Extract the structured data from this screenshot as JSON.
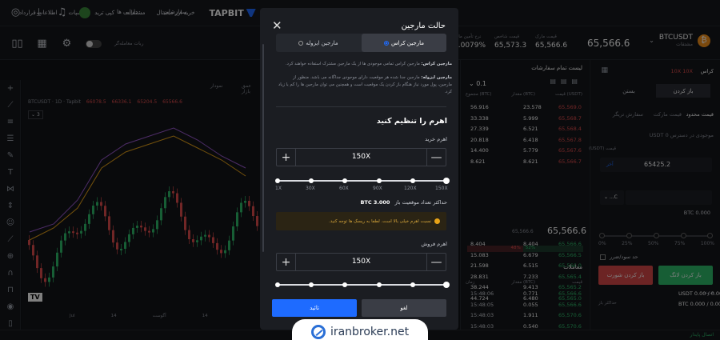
{
  "topbar": {
    "logo": "TAPBIT",
    "nav": [
      "خرید ارز دیجیتال",
      "مشتقات",
      "کپی ترید",
      "اسپات",
      "اطلاعات قرارداد"
    ],
    "right_menu": [
      "سفارشات",
      "دارایی ها"
    ]
  },
  "ticker": {
    "pair": "BTCUSDT",
    "pair_sub": "مشتقات",
    "price": "65,566.6",
    "stats": [
      {
        "label": "قیمت مارک",
        "value": "65,566.6"
      },
      {
        "label": "قیمت شاخص",
        "value": "65,573.3"
      },
      {
        "label": "نرخ تأمین مالی",
        "value": "0.0079%"
      }
    ],
    "mode_label": "ربات معامله‌گر"
  },
  "chart": {
    "title": "BTCUSDT · 1D · Tapbit",
    "ohlc": [
      "66078.5",
      "66336.1",
      "65204.5",
      "65566.6"
    ],
    "interval": "3",
    "tab_label": "نمودار",
    "tab_depth": "عمق بازار",
    "x_ticks": [
      "Jul",
      "14",
      "آگوست",
      "14",
      "سپتامبر"
    ]
  },
  "orderbook": {
    "title": "لیست تمام سفارشات",
    "tick": "0.1",
    "cols": [
      "مجموع (BTC)",
      "مقدار (BTC)",
      "قیمت (USDT)"
    ],
    "asks": [
      [
        "56.916",
        "23.578",
        "65,569.0"
      ],
      [
        "33.338",
        "5.999",
        "65,568.7"
      ],
      [
        "27.339",
        "6.521",
        "65,568.4"
      ],
      [
        "20.818",
        "6.418",
        "65,567.8"
      ],
      [
        "14.400",
        "5.779",
        "65,567.6"
      ],
      [
        "8.621",
        "8.621",
        "65,566.7"
      ]
    ],
    "mid": "65,566.6",
    "mid_small": "65,566.6",
    "bids": [
      [
        "8.404",
        "8.404",
        "65,566.6"
      ],
      [
        "15.083",
        "6.679",
        "65,566.5"
      ],
      [
        "21.598",
        "6.515",
        "65,566.0"
      ],
      [
        "28.831",
        "7.233",
        "65,565.4"
      ],
      [
        "38.244",
        "9.413",
        "65,565.2"
      ],
      [
        "44.724",
        "6.480",
        "65,565.0"
      ]
    ],
    "ratio_buy": "52%",
    "ratio_sell": "48%",
    "trades_title": "معاملات",
    "trade_cols": [
      "زمان",
      "مقدار (BTC)",
      "قیمت"
    ],
    "trades": [
      [
        "15:48:06",
        "0.771",
        "65,566.6"
      ],
      [
        "15:48:05",
        "0.055",
        "65,566.6"
      ],
      [
        "15:48:03",
        "1.911",
        "65,570.6"
      ],
      [
        "15:48:03",
        "0.540",
        "65,570.6"
      ]
    ]
  },
  "right_panel": {
    "margin_mode": "کراس",
    "leverage_pair": "10X  10X",
    "tab_open": "باز کردن",
    "tab_close": "بستن",
    "order_types": [
      "قیمت محدود",
      "قیمت مارکت",
      "سفارش تریگر"
    ],
    "available": "موجودی در دسترس 0 USDT",
    "price_label": "قیمت (USDT)",
    "price_value": "65425.2",
    "price_tag": "آخر",
    "qty_btc": "BTC 0.000",
    "percents": [
      "0%",
      "25%",
      "50%",
      "75%",
      "100%"
    ],
    "tpsl": "حد سود/ضرر",
    "btn_long": "باز کردن لانگ",
    "btn_short": "باز کردن شورت",
    "usdt_line": "USDT 0.00 / 0.00",
    "btc_line": "BTC 0.000 / 0.000",
    "cost_label": "هزینه",
    "max_label": "حداکثر باز"
  },
  "status": "اتصال پایدار",
  "modal": {
    "title": "حالت مارجین",
    "cross": "مارجین کراس",
    "isolated": "مارجین ایزوله",
    "desc_cross_title": "مارجین کراس:",
    "desc_cross": "مارجین کراس تمامی موجودی ها از یک مارجین مشترک استفاده خواهند کرد.",
    "desc_iso_title": "مارجین ایزوله:",
    "desc_iso": "مارجین جدا شده هر موقعیت دارای موجودی جداگانه می باشد. منظور از مارجین، پول مورد نیاز هنگام باز کردن یک موقعیت است و همچنین می توان مارجین ها را کم یا زیاد کرد.",
    "leverage_title": "اهرم را تنظیم کنید",
    "buy_label": "اهرم خرید",
    "buy_value": "150X",
    "ticks": [
      "1X",
      "30X",
      "60X",
      "90X",
      "120X",
      "150X"
    ],
    "max_pos_label": "حداکثر تعداد موقعیت باز",
    "max_pos_value": "BTC 3.000",
    "warning": "نسبت اهرم خیلی بالا است. لطفا به ریسک ها توجه کنید.",
    "sell_label": "اهرم فروش",
    "sell_value": "150X",
    "confirm": "تائید",
    "cancel": "لغو"
  },
  "watermark": "iranbroker.net"
}
